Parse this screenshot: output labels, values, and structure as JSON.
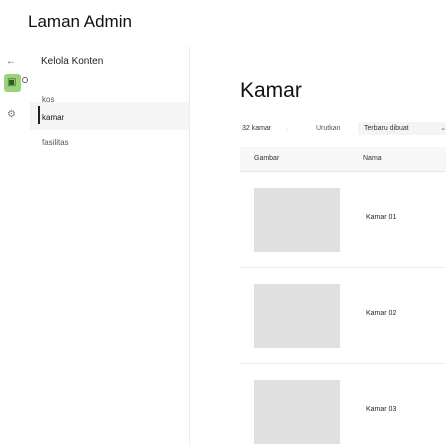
{
  "app": {
    "title": "Laman Admin"
  },
  "sidebar": {
    "header_label": "Kelola Konten",
    "items": [
      {
        "label": "kos"
      },
      {
        "label": "kamar"
      },
      {
        "label": "fasilitas"
      }
    ]
  },
  "main": {
    "title": "Kamar",
    "count_label": "32 kamar",
    "separator": ".",
    "sort_label": "Urutkan",
    "sort_value": "Terbaru dibuat",
    "table": {
      "columns": [
        "Gambar",
        "Nama"
      ],
      "rows": [
        {
          "name": "Kamar 01"
        },
        {
          "name": "Kamar 02"
        },
        {
          "name": "Kamar 03"
        }
      ]
    }
  }
}
